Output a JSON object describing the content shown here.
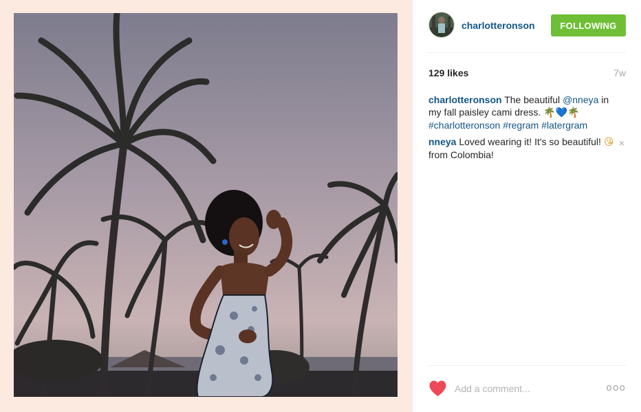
{
  "post": {
    "username": "charlotteronson",
    "follow_label": "FOLLOWING",
    "likes": "129 likes",
    "time_ago": "7w"
  },
  "caption": {
    "user": "charlotteronson",
    "text_1": " The beautiful ",
    "mention": "@nneya",
    "text_2": " in my fall paisley cami dress. ",
    "emoji_palm": "🌴",
    "emoji_heart": "💙",
    "hashtags": [
      "#charlotteronson",
      "#regram",
      "#latergram"
    ]
  },
  "comment": {
    "user": "nneya",
    "text_1": " Loved wearing it! It's so beautiful! ",
    "emoji_kiss": "😘",
    "text_2": " from Colombia!",
    "delete_icon": "×"
  },
  "footer": {
    "comment_placeholder": "Add a comment...",
    "more_label": "ooo"
  },
  "colors": {
    "username_link": "#125688",
    "follow_button": "#6fbf36",
    "like_heart": "#ed4956",
    "media_background": "#fce9df"
  },
  "icons": {
    "like": "heart-icon",
    "more": "more-options-icon",
    "delete": "close-icon"
  }
}
